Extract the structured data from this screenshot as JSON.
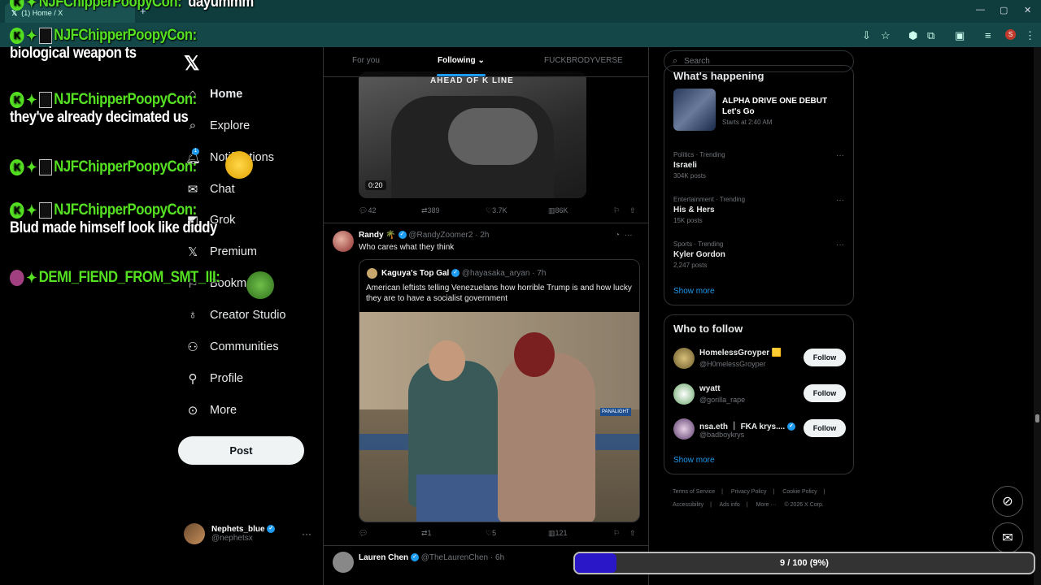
{
  "browser": {
    "tab_title": "(1) Home / X",
    "new_tab": "+",
    "minimize": "—",
    "maximize": "▢",
    "close": "✕",
    "profile_letter": "S"
  },
  "nav": {
    "items": [
      {
        "label": "Home",
        "icon": "home-icon"
      },
      {
        "label": "Explore",
        "icon": "search-icon"
      },
      {
        "label": "Notifications",
        "icon": "bell-icon"
      },
      {
        "label": "Chat",
        "icon": "mail-icon"
      },
      {
        "label": "Grok",
        "icon": "grok-icon"
      },
      {
        "label": "Premium",
        "icon": "x-icon"
      },
      {
        "label": "Bookmarks",
        "icon": "bookmark-icon"
      },
      {
        "label": "Creator Studio",
        "icon": "flask-icon"
      },
      {
        "label": "Communities",
        "icon": "people-icon"
      },
      {
        "label": "Profile",
        "icon": "person-icon"
      },
      {
        "label": "More",
        "icon": "more-icon"
      }
    ],
    "post_label": "Post",
    "notif_badge": "1"
  },
  "me": {
    "name": "Nephets_blue",
    "handle": "@nephetsx"
  },
  "timeline": {
    "tabs": [
      "For you",
      "Following",
      "FUCKBRODYVERSE"
    ],
    "tweet1": {
      "video_text": "AHEAD OF      K LINE",
      "duration": "0:20",
      "replies": "42",
      "reposts": "389",
      "likes": "3.7K",
      "views": "86K"
    },
    "tweet2": {
      "name": "Randy 🌴",
      "handle": "@RandyZoomer2 · 2h",
      "text": "Who cares what they think",
      "quote_name": "Kaguya's Top Gal",
      "quote_handle": "@hayasaka_aryan · 7h",
      "quote_text": "American leftists telling Venezuelans how horrible Trump is and how lucky they are to have a socialist government",
      "image_sign": "PANALIGHT",
      "replies": "",
      "reposts": "1",
      "likes": "5",
      "views": "121"
    },
    "tweet3": {
      "name": "Lauren Chen",
      "handle": "@TheLaurenChen · 6h"
    }
  },
  "sidebar": {
    "search_placeholder": "Search",
    "whats_happening": "What's happening",
    "event_title": "ALPHA DRIVE ONE DEBUT",
    "event_sub": "Let's Go",
    "event_time": "Starts at 2:40 AM",
    "trends": [
      {
        "meta": "Politics · Trending",
        "topic": "Israeli",
        "count": "304K posts"
      },
      {
        "meta": "Entertainment · Trending",
        "topic": "His & Hers",
        "count": "15K posts"
      },
      {
        "meta": "Sports · Trending",
        "topic": "Kyler Gordon",
        "count": "2,247 posts"
      }
    ],
    "show_more": "Show more",
    "who_to_follow": "Who to follow",
    "follow_label": "Follow",
    "accounts": [
      {
        "name": "HomelessGroyper 🟨",
        "handle": "@H0melessGroyper"
      },
      {
        "name": "wyatt",
        "handle": "@gorilla_rape"
      },
      {
        "name": "nsa.eth ｜ FKA krys....",
        "handle": "@badboykrys"
      }
    ],
    "footer": [
      "Terms of Service",
      "|",
      "Privacy Policy",
      "|",
      "Cookie Policy",
      "|",
      "Accessibility",
      "|",
      "Ads info",
      "|",
      "More ···",
      "© 2026 X Corp."
    ]
  },
  "chat": [
    {
      "user": "NJFChipperPoopyCon:",
      "msg": "dayummm"
    },
    {
      "user": "NJFChipperPoopyCon:",
      "msg": "biological weapon ts"
    },
    {
      "user": "NJFChipperPoopyCon:",
      "msg": "they've already decimated us"
    },
    {
      "user": "NJFChipperPoopyCon:",
      "msg": ""
    },
    {
      "user": "NJFChipperPoopyCon:",
      "msg": "Blud made himself look like diddy"
    },
    {
      "user": "DEMI_FIEND_FROM_SMT_III:",
      "msg": ""
    }
  ],
  "progress": {
    "text": "9 / 100 (9%)",
    "fraction": 0.09
  },
  "colors": {
    "accent": "#1d9bf0",
    "chat_name": "#55e022",
    "progress_fill": "#2a17c8"
  }
}
